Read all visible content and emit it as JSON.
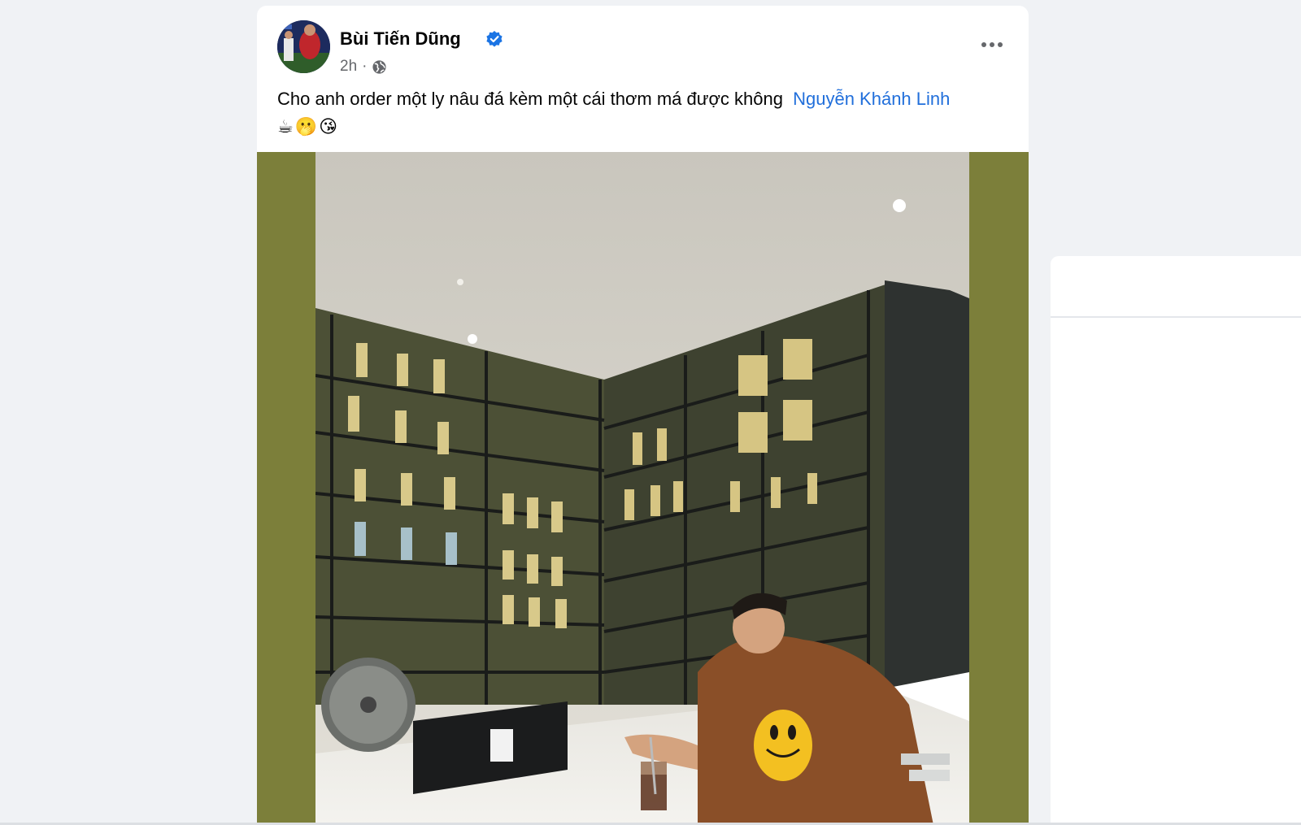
{
  "post": {
    "author": {
      "name": "Bùi Tiến Dũng",
      "verified": true,
      "avatar": "avatar-photo"
    },
    "meta": {
      "time": "2h",
      "separator": "·",
      "audience_icon": "globe-icon"
    },
    "more_icon": "more-horizontal-icon",
    "text": "Cho anh order một ly nâu đá kèm một cái thơm má được không",
    "mention": "Nguyễn Khánh Linh",
    "emojis": "☕🫢😘",
    "photo": {
      "frame_color": "#7c7f3a",
      "description_icon": "post-photo"
    }
  },
  "colors": {
    "page_background": "#f0f2f5",
    "card_background": "#ffffff",
    "mention_link": "#216fdb",
    "verified_badge": "#1b74e4",
    "secondary_text": "#65676b"
  }
}
